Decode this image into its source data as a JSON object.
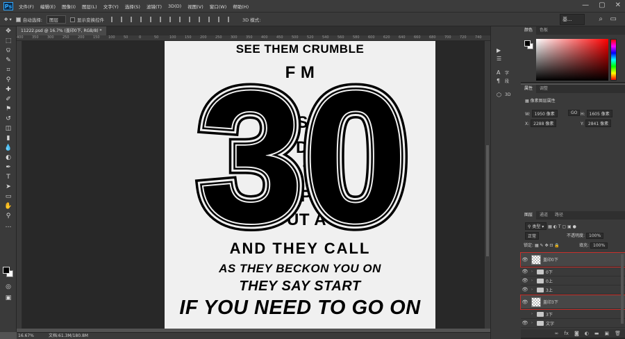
{
  "app": {
    "logo": "Ps"
  },
  "menus": [
    "文件(F)",
    "编辑(E)",
    "图像(I)",
    "图层(L)",
    "文字(Y)",
    "选择(S)",
    "滤镜(T)",
    "3D(D)",
    "视图(V)",
    "窗口(W)",
    "帮助(H)"
  ],
  "window_controls": {
    "minimize": "—",
    "maximize": "▢",
    "close": "✕"
  },
  "options": {
    "auto_select_label": "自动选择:",
    "auto_select_value": "图层",
    "show_transform_label": "显示变换控件",
    "mode_3d": "3D 模式:",
    "workspace": "基..."
  },
  "document": {
    "tab_title": "11222.psd @ 16.7% (盖印0下, RGB/8) *",
    "zoom": "16.67%",
    "doc_info": "文档:61.3M/180.8M",
    "ruler_ticks": [
      "400",
      "350",
      "300",
      "250",
      "200",
      "150",
      "100",
      "50",
      "0",
      "50",
      "100",
      "150",
      "200",
      "250",
      "300",
      "350",
      "400",
      "450",
      "500",
      "520",
      "540",
      "560",
      "580",
      "600",
      "620",
      "640",
      "660",
      "680",
      "700",
      "720",
      "740"
    ]
  },
  "artwork": {
    "big_number": "30",
    "lines": [
      "SEE THEM CRUMBLE",
      "F M",
      "TH  SES",
      "T   DE",
      "S    T",
      "AP",
      "OUT A",
      "AND THEY CALL",
      "AS THEY BECKON YOU ON",
      "THEY SAY START",
      "IF YOU NEED TO GO ON"
    ]
  },
  "mini_panels": [
    {
      "icon": "▶",
      "label": ""
    },
    {
      "icon": "☰",
      "label": ""
    },
    {
      "icon": "A",
      "label": "字"
    },
    {
      "icon": "¶",
      "label": "段"
    },
    {
      "icon": "⬡",
      "label": "3D"
    }
  ],
  "color_panel": {
    "tabs": [
      "颜色",
      "色板"
    ]
  },
  "properties_panel": {
    "tabs": [
      "属性",
      "调整"
    ],
    "layer_type": "像素图层属性",
    "w_label": "W:",
    "w_value": "1950 像素",
    "link": "GO",
    "h_label": "H:",
    "h_value": "1605 像素",
    "x_label": "X:",
    "x_value": "2288 像素",
    "y_label": "Y:",
    "y_value": "2841 像素"
  },
  "layers_panel": {
    "tabs": [
      "图层",
      "通道",
      "路径"
    ],
    "filter_kind": "类型",
    "blend_mode": "正常",
    "opacity_label": "不透明度:",
    "opacity_value": "100%",
    "lock_label": "锁定:",
    "fill_label": "填充:",
    "fill_value": "100%",
    "layers": [
      {
        "name": "盖印0下",
        "type": "pixel",
        "highlight": true
      },
      {
        "name": "0下",
        "type": "folder",
        "highlight": false
      },
      {
        "name": "0上",
        "type": "folder",
        "highlight": false
      },
      {
        "name": "3上",
        "type": "folder",
        "highlight": false
      },
      {
        "name": "盖印3下",
        "type": "pixel",
        "highlight": true
      },
      {
        "name": "3下",
        "type": "folder",
        "highlight": false
      },
      {
        "name": "文字",
        "type": "folder",
        "highlight": false
      },
      {
        "name": "",
        "type": "pixel",
        "highlight": false
      }
    ]
  },
  "colors": {
    "highlight_outline": "#c8302b",
    "artboard": "#f0f0f0",
    "canvas": "#282828"
  }
}
